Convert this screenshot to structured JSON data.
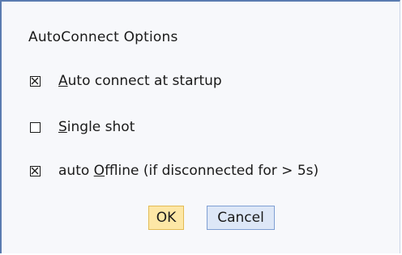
{
  "dialog": {
    "title": "AutoConnect Options",
    "options": [
      {
        "checked": true,
        "pre": "",
        "accel": "A",
        "post": "uto connect at startup"
      },
      {
        "checked": false,
        "pre": "",
        "accel": "S",
        "post": "ingle shot"
      },
      {
        "checked": true,
        "pre": "auto ",
        "accel": "O",
        "post": "ffline (if disconnected for > 5s)"
      }
    ],
    "ok_label": "OK",
    "cancel_label": "Cancel"
  },
  "colors": {
    "ok_bg": "#fde7a6",
    "cancel_bg": "#dde7f7",
    "frame": "#5a7bb0"
  },
  "icons": [
    "checkbox-checked-icon",
    "checkbox-unchecked-icon"
  ]
}
